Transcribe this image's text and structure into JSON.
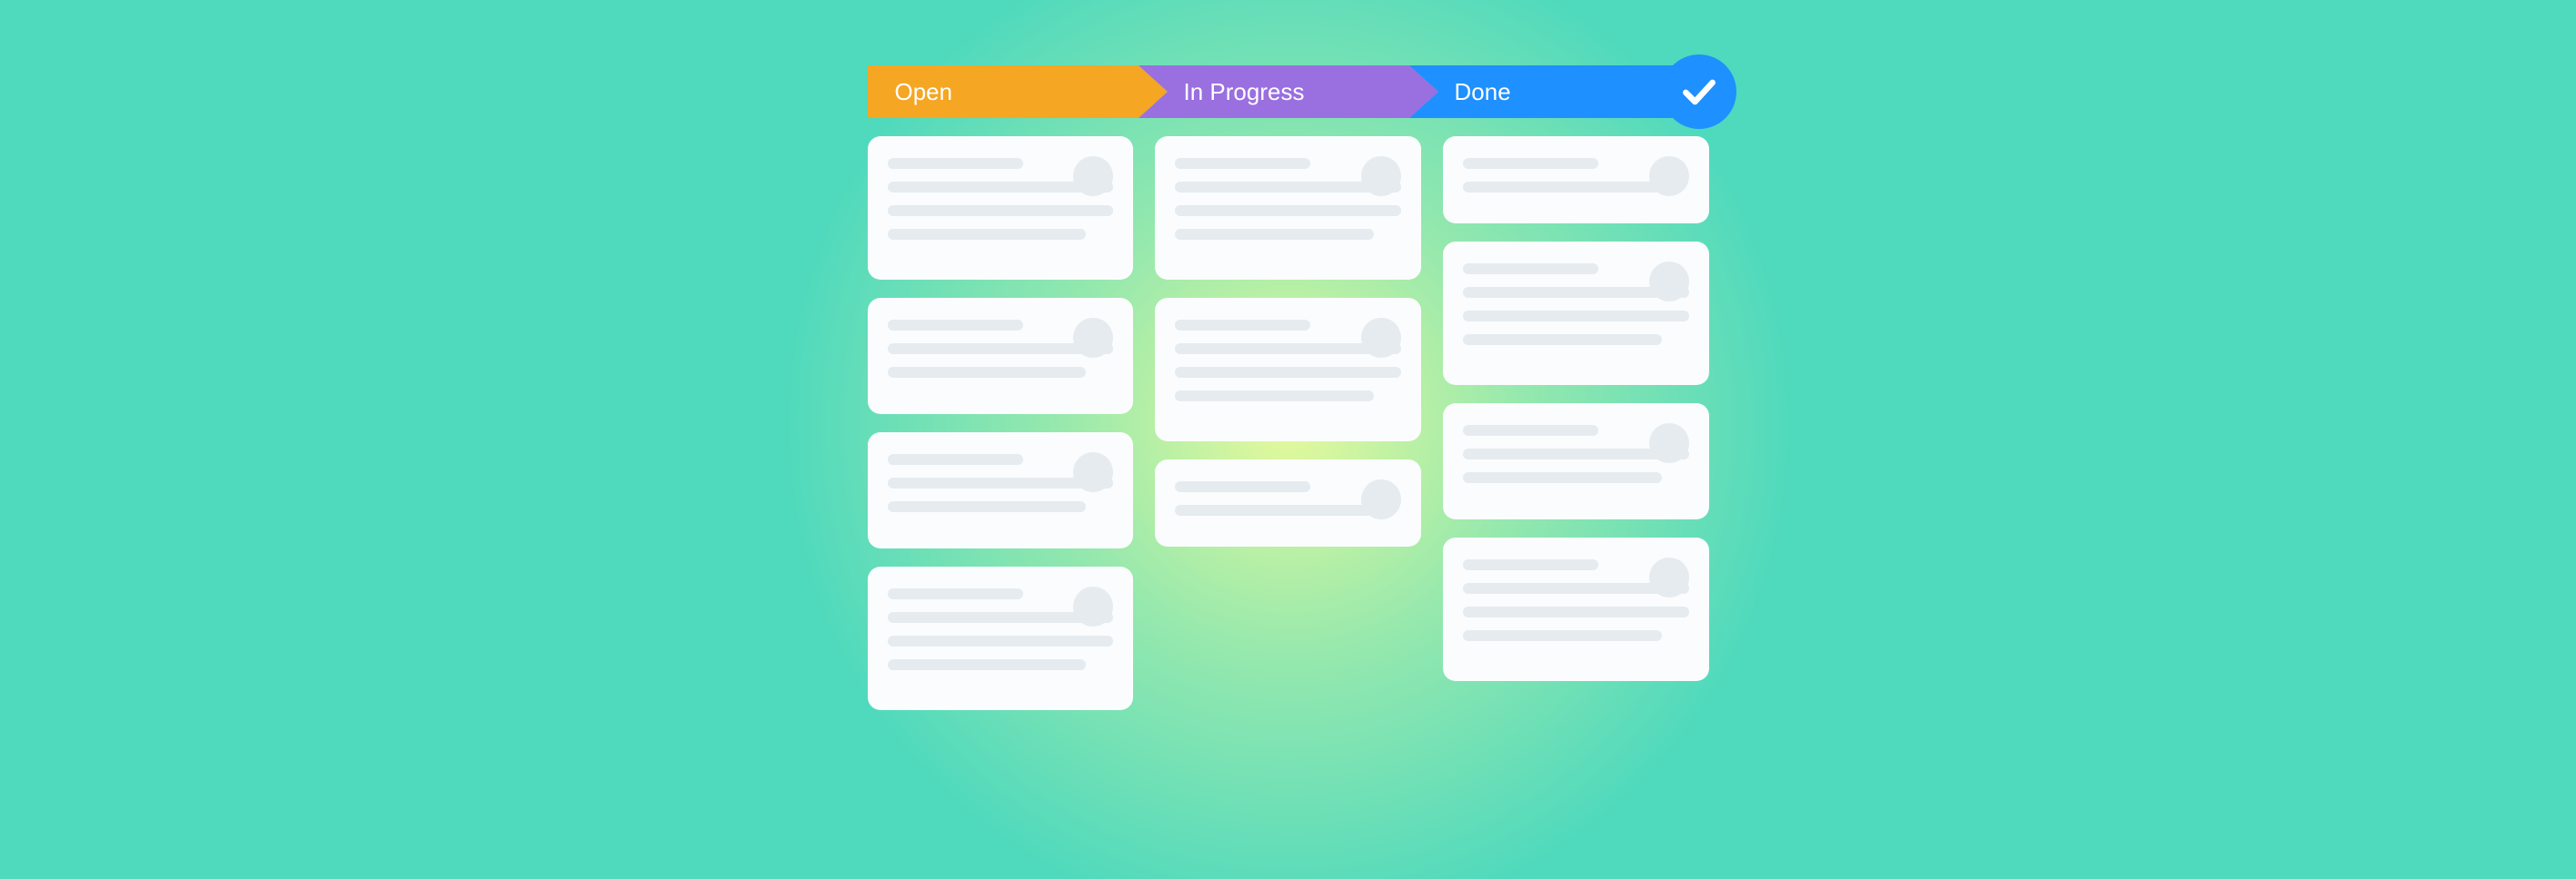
{
  "stages": {
    "open": {
      "label": "Open",
      "color": "#f5a623"
    },
    "in_progress": {
      "label": "In Progress",
      "color": "#9a6fe0"
    },
    "done": {
      "label": "Done",
      "color": "#1e90ff"
    }
  },
  "badge": {
    "icon": "checkmark",
    "color": "#1e90ff"
  },
  "columns": {
    "open": {
      "card_count": 4
    },
    "in_progress": {
      "card_count": 3
    },
    "done": {
      "card_count": 4
    }
  }
}
